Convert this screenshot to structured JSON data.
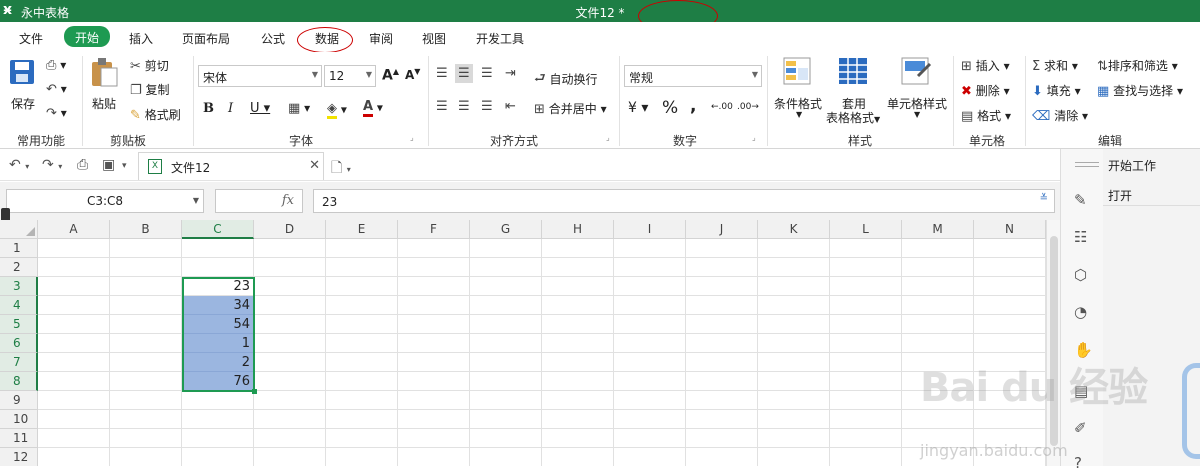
{
  "titlebar": {
    "app_logo": "ӿ",
    "app_name": "永中表格",
    "doc_title": "文件12 *"
  },
  "menu": {
    "items": [
      "文件",
      "开始",
      "插入",
      "页面布局",
      "公式",
      "数据",
      "审阅",
      "视图",
      "开发工具"
    ],
    "active": "开始"
  },
  "ribbon": {
    "groups": [
      "常用功能",
      "剪贴板",
      "字体",
      "对齐方式",
      "数字",
      "样式",
      "单元格",
      "编辑"
    ],
    "common": {
      "save": "保存"
    },
    "clipboard": {
      "paste": "粘贴",
      "cut": "剪切",
      "copy": "复制",
      "format_painter": "格式刷"
    },
    "font": {
      "name": "宋体",
      "size": "12",
      "grow": "A",
      "shrink": "A",
      "bold": "B",
      "italic": "I",
      "underline": "U",
      "font_color": "A"
    },
    "align": {
      "wrap": "自动换行",
      "merge": "合并居中"
    },
    "number": {
      "format": "常规",
      "currency": "¥",
      "percent": "%",
      "comma": ",",
      "inc_decimal": ".00",
      "dec_decimal": ".00"
    },
    "styles": {
      "conditional": "条件格式",
      "table_style_1": "套用",
      "table_style_2": "表格格式",
      "cell_style": "单元格样式"
    },
    "cells": {
      "insert": "插入",
      "delete": "删除",
      "format": "格式"
    },
    "editing": {
      "sum": "求和",
      "sort": "排序和筛选",
      "fill": "填充",
      "find": "查找与选择",
      "clear": "清除"
    }
  },
  "document_tab": {
    "label": "文件12",
    "file_icon": "X"
  },
  "formula_bar": {
    "name_box": "C3:C8",
    "fx": "fx",
    "value": "23"
  },
  "sheet": {
    "columns": [
      "A",
      "B",
      "C",
      "D",
      "E",
      "F",
      "G",
      "H",
      "I",
      "J",
      "K",
      "L",
      "M",
      "N"
    ],
    "rows": [
      "1",
      "2",
      "3",
      "4",
      "5",
      "6",
      "7",
      "8",
      "9",
      "10",
      "11",
      "12"
    ],
    "selected_range": "C3:C8",
    "cells": [
      {
        "ref": "C3",
        "value": "23"
      },
      {
        "ref": "C4",
        "value": "34"
      },
      {
        "ref": "C5",
        "value": "54"
      },
      {
        "ref": "C6",
        "value": "1"
      },
      {
        "ref": "C7",
        "value": "2"
      },
      {
        "ref": "C8",
        "value": "76"
      }
    ]
  },
  "task_pane": {
    "items": [
      "开始工作",
      "打开"
    ]
  },
  "watermark": {
    "logo": "Bai du 经验",
    "url": "jingyan.baidu.com"
  },
  "colors": {
    "titlebar": "#1e7e45",
    "active_tab": "#1e9a52",
    "selection_fill": "#9bb6e0",
    "annotation": "#cc0000"
  }
}
